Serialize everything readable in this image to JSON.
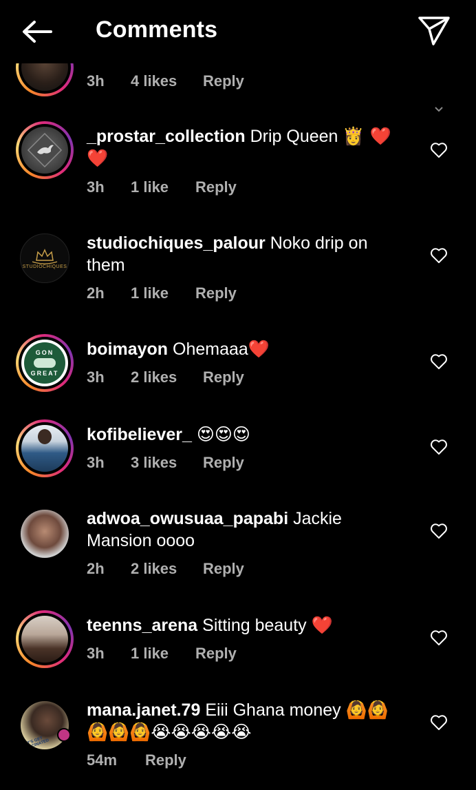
{
  "header": {
    "title": "Comments"
  },
  "partial_top": {
    "time": "3h",
    "likes": "4 likes",
    "reply": "Reply"
  },
  "comments": [
    {
      "username": "_prostar_collection",
      "text": "Drip Queen",
      "emoji": "👸 ❤️",
      "emoji_line2": "❤️",
      "time": "3h",
      "likes": "1 like",
      "reply": "Reply"
    },
    {
      "username": "studiochiques_palour",
      "text": "Noko drip on",
      "text_line2": "them",
      "time": "2h",
      "likes": "1 like",
      "reply": "Reply"
    },
    {
      "username": "boimayon",
      "text": "Ohemaaa",
      "emoji": "❤️",
      "time": "3h",
      "likes": "2 likes",
      "reply": "Reply"
    },
    {
      "username": "kofibeliever_",
      "emoji": "😍😍😍",
      "time": "3h",
      "likes": "3 likes",
      "reply": "Reply"
    },
    {
      "username": "adwoa_owusuaa_papabi",
      "text": "Jackie",
      "text_line2": "Mansion oooo",
      "time": "2h",
      "likes": "2 likes",
      "reply": "Reply"
    },
    {
      "username": "teenns_arena",
      "text": "Sitting beauty",
      "emoji": "❤️",
      "time": "3h",
      "likes": "1 like",
      "reply": "Reply"
    },
    {
      "username": "mana.janet.79",
      "text": "Eiii Ghana money",
      "emoji": "🙆🙆",
      "emoji_line2": "🙆🙆🙆😭😭😭😭😭",
      "time": "54m",
      "reply": "Reply"
    }
  ],
  "avatar_logos": {
    "boimayon_top": "GON",
    "boimayon_bottom": "GREAT",
    "studiochiques_logo": "STUDIOCHIQUES",
    "mana_badge": "LET'S GET VACCINATED"
  },
  "colors": {
    "background": "#000000",
    "text": "#ffffff",
    "meta": "#b0b0b0",
    "heart_emoji": "#e0102a"
  }
}
